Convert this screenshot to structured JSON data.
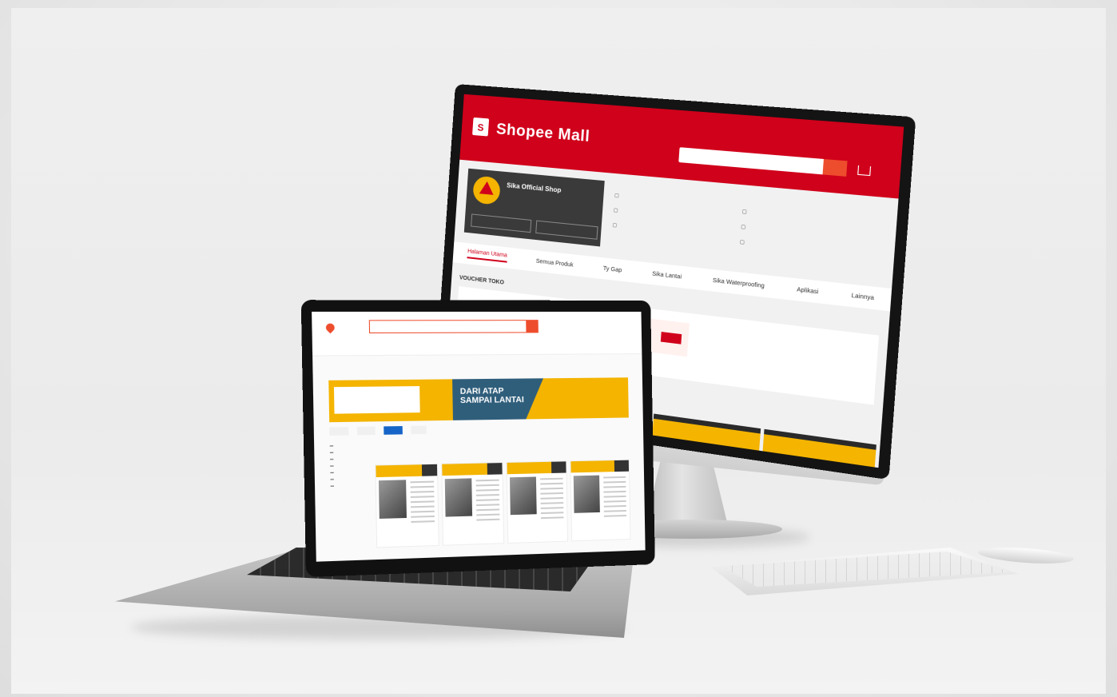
{
  "scene": {
    "background_color": "#ececec",
    "devices": [
      "desktop-monitor",
      "laptop",
      "keyboard",
      "mouse"
    ]
  },
  "desktop_screen": {
    "brand_color": "#d0011b",
    "logo_text": "Shopee Mall",
    "shop_name": "Sika Official Shop",
    "nav_items": [
      "Halaman Utama",
      "Semua Produk",
      "Ty Gap",
      "Sika Lantai",
      "Sika Waterproofing",
      "Aplikasi",
      "Lainnya"
    ],
    "voucher_heading": "VOUCHER TOKO"
  },
  "laptop_screen": {
    "accent_color": "#ee4d2d",
    "banner_color": "#f4b400",
    "banner_text_line1": "DARI ATAP",
    "banner_text_line2": "SAMPAI LANTAI"
  }
}
